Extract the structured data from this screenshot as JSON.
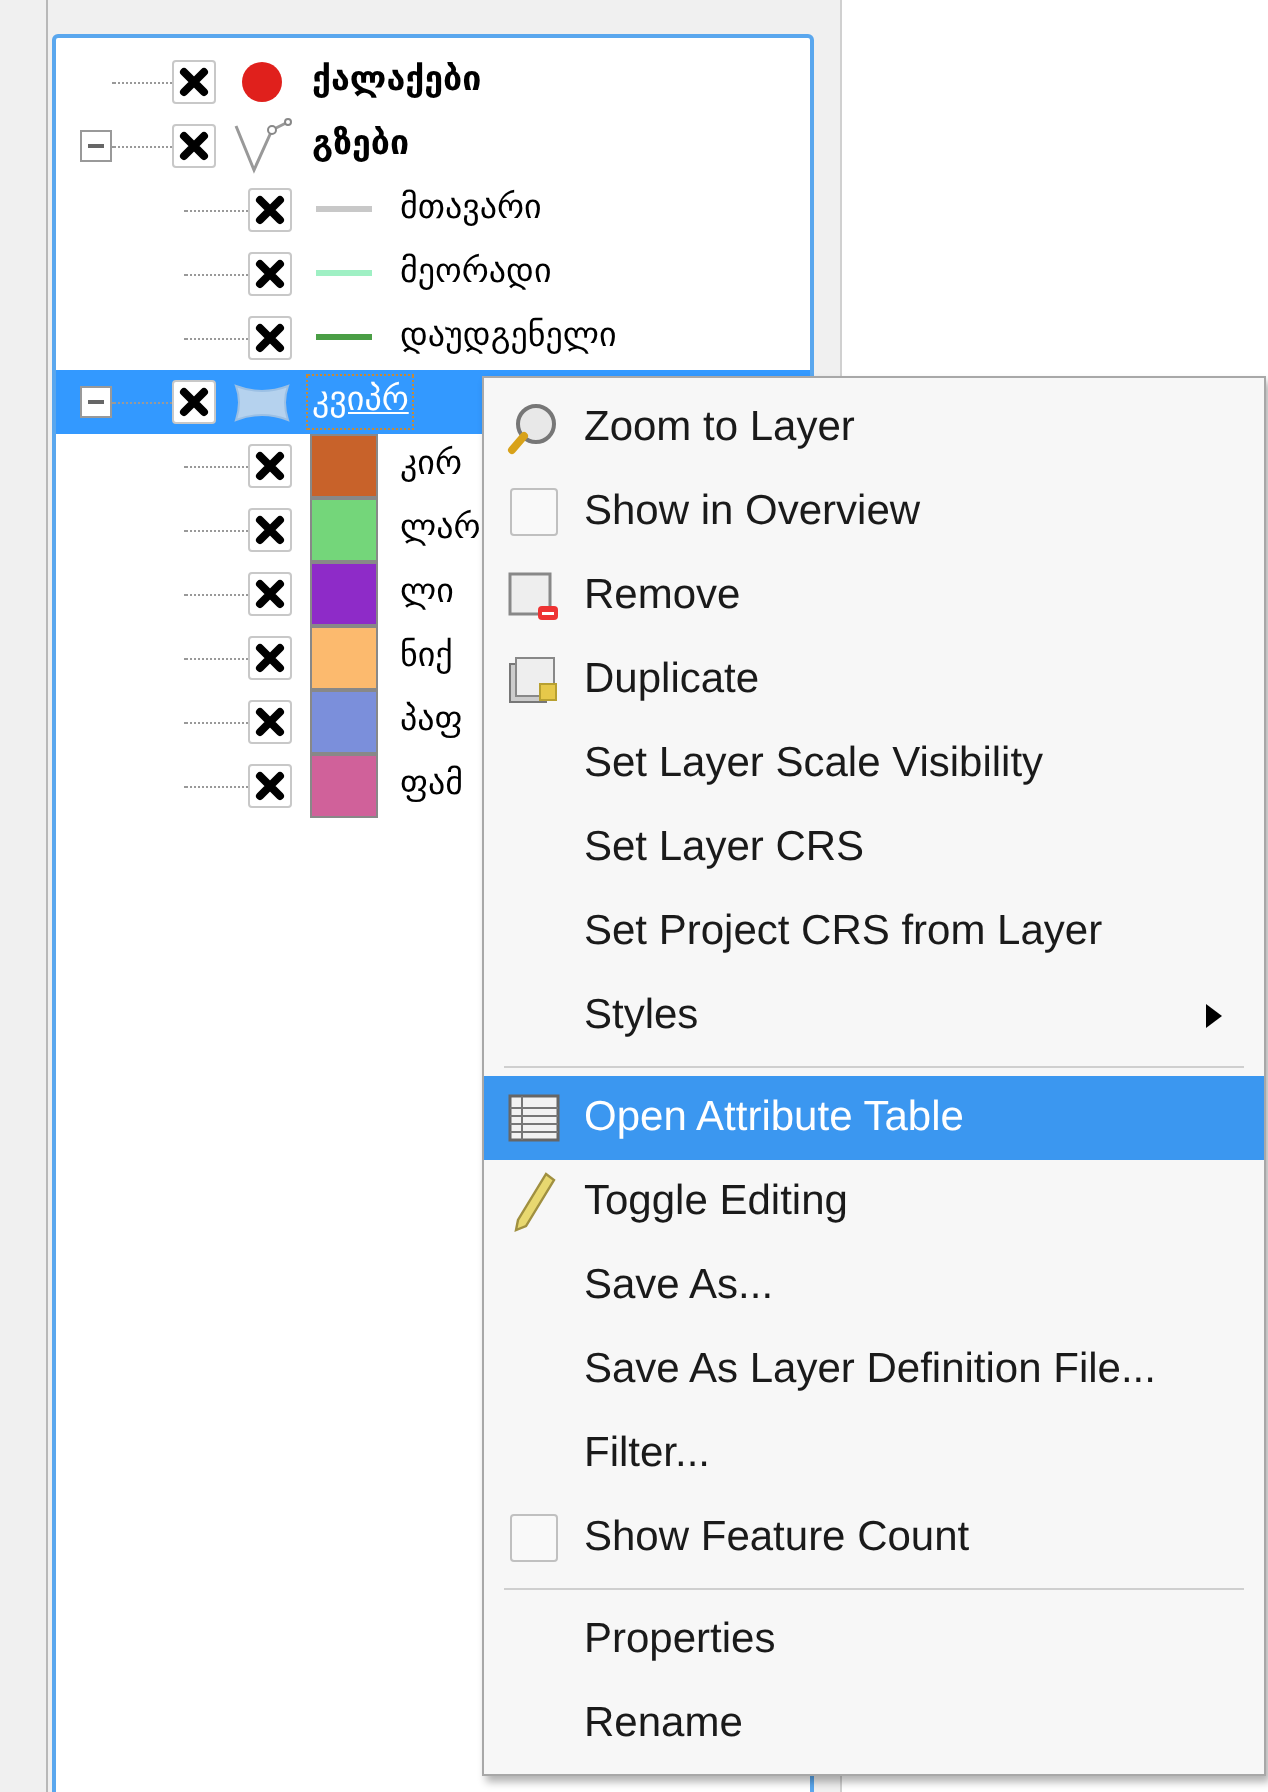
{
  "layers": [
    {
      "name": "ქალაქები",
      "bold": true,
      "checked": true,
      "kind": "point",
      "color": "#e0201c",
      "selected": false
    },
    {
      "name": "გზები",
      "bold": true,
      "checked": true,
      "kind": "line-group",
      "selected": false,
      "expanded": true,
      "children": [
        {
          "name": "მთავარი",
          "checked": true,
          "kind": "line",
          "color": "#c8c8c8",
          "selected": false
        },
        {
          "name": "მეორადი",
          "checked": true,
          "kind": "line",
          "color": "#9ff0c4",
          "selected": false
        },
        {
          "name": "დაუდგენელი",
          "checked": true,
          "kind": "line",
          "color": "#4a9e45",
          "selected": false
        }
      ]
    },
    {
      "name": "კვიპრ",
      "bold": false,
      "checked": true,
      "kind": "polygon-group",
      "selected": true,
      "expanded": true,
      "children": [
        {
          "name": "კირ",
          "checked": true,
          "kind": "fill",
          "color": "#c8622a",
          "selected": false
        },
        {
          "name": "ლარ",
          "checked": true,
          "kind": "fill",
          "color": "#74d67a",
          "selected": false
        },
        {
          "name": "ლი",
          "checked": true,
          "kind": "fill",
          "color": "#8e2bc8",
          "selected": false
        },
        {
          "name": "ნიქ",
          "checked": true,
          "kind": "fill",
          "color": "#fcba6e",
          "selected": false
        },
        {
          "name": "პაფ",
          "checked": true,
          "kind": "fill",
          "color": "#7b8fdb",
          "selected": false
        },
        {
          "name": "ფამ",
          "checked": true,
          "kind": "fill",
          "color": "#d0619a",
          "selected": false
        }
      ]
    }
  ],
  "context_menu": [
    {
      "kind": "item",
      "label": "Zoom to Layer",
      "selected": false
    },
    {
      "kind": "check",
      "label": "Show in Overview",
      "checked": false,
      "selected": false
    },
    {
      "kind": "item",
      "label": "Remove",
      "selected": false
    },
    {
      "kind": "item",
      "label": "Duplicate",
      "selected": false
    },
    {
      "kind": "item",
      "label": "Set Layer Scale Visibility",
      "selected": false
    },
    {
      "kind": "item",
      "label": "Set Layer CRS",
      "selected": false
    },
    {
      "kind": "item",
      "label": "Set Project CRS from Layer",
      "selected": false
    },
    {
      "kind": "submenu",
      "label": "Styles",
      "selected": false
    },
    {
      "kind": "separator"
    },
    {
      "kind": "item",
      "label": "Open Attribute Table",
      "selected": true
    },
    {
      "kind": "item",
      "label": "Toggle Editing",
      "selected": false
    },
    {
      "kind": "item",
      "label": "Save As...",
      "selected": false
    },
    {
      "kind": "item",
      "label": "Save As Layer Definition File...",
      "selected": false
    },
    {
      "kind": "item",
      "label": "Filter...",
      "selected": false
    },
    {
      "kind": "check",
      "label": "Show Feature Count",
      "checked": false,
      "selected": false
    },
    {
      "kind": "separator"
    },
    {
      "kind": "item",
      "label": "Properties",
      "selected": false
    },
    {
      "kind": "item",
      "label": "Rename",
      "selected": false
    }
  ]
}
